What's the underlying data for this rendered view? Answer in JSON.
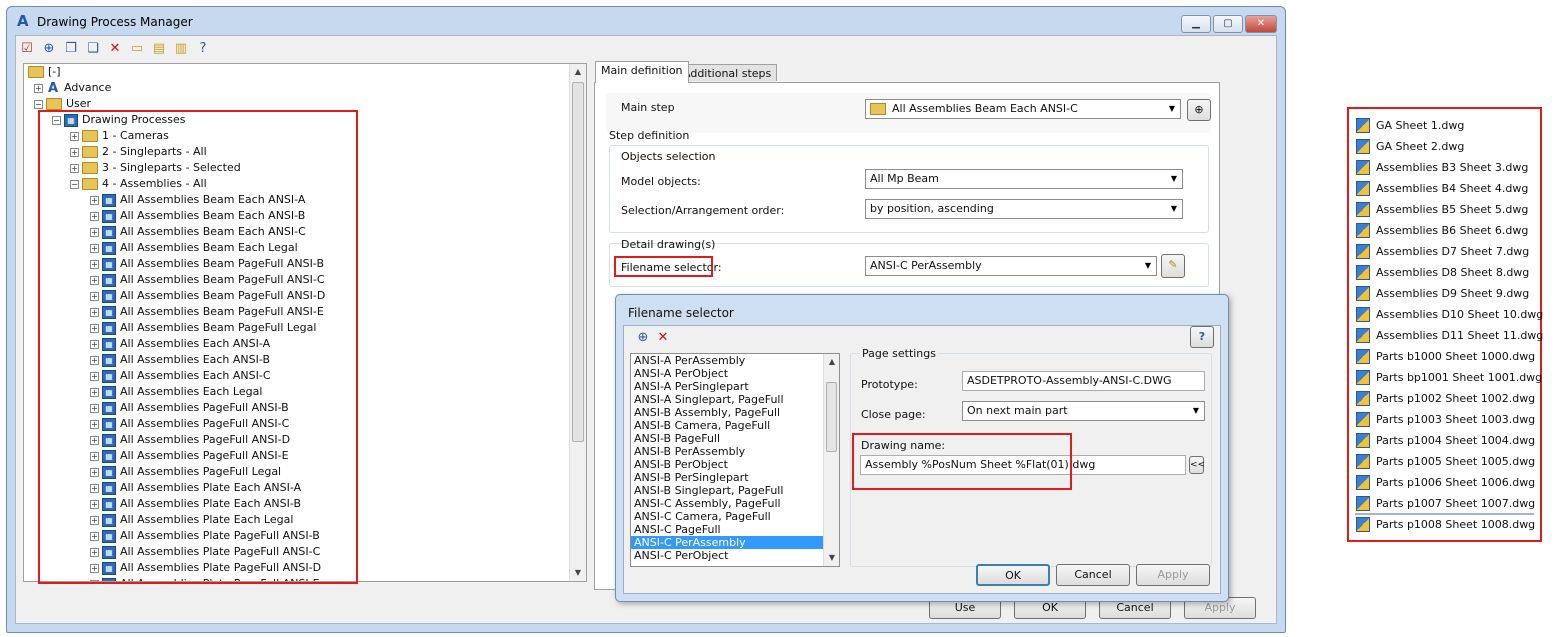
{
  "window": {
    "title": "Drawing Process Manager",
    "min": "▁",
    "max": "▢",
    "close": "✕"
  },
  "toolbar": {
    "icons": [
      "check-doc-icon",
      "add-icon",
      "copy-icon",
      "paste-icon",
      "delete-icon",
      "monitor-icon",
      "folder-open-icon",
      "folder-import-icon",
      "help-icon"
    ]
  },
  "tree": {
    "root": "[-]",
    "advance": "Advance",
    "user": "User",
    "drawing_processes": "Drawing Processes",
    "groups": [
      "1 - Cameras",
      "2 - Singleparts - All",
      "3 - Singleparts - Selected",
      "4 - Assemblies - All"
    ],
    "items": [
      "All Assemblies Beam Each ANSI-A",
      "All Assemblies Beam Each ANSI-B",
      "All Assemblies Beam Each ANSI-C",
      "All Assemblies Beam Each Legal",
      "All Assemblies Beam PageFull ANSI-B",
      "All Assemblies Beam PageFull ANSI-C",
      "All Assemblies Beam PageFull ANSI-D",
      "All Assemblies Beam PageFull ANSI-E",
      "All Assemblies Beam PageFull Legal",
      "All Assemblies Each ANSI-A",
      "All Assemblies Each ANSI-B",
      "All Assemblies Each ANSI-C",
      "All Assemblies Each Legal",
      "All Assemblies PageFull ANSI-B",
      "All Assemblies PageFull ANSI-C",
      "All Assemblies PageFull ANSI-D",
      "All Assemblies PageFull ANSI-E",
      "All Assemblies PageFull Legal",
      "All Assemblies Plate Each ANSI-A",
      "All Assemblies Plate Each ANSI-B",
      "All Assemblies Plate Each Legal",
      "All Assemblies Plate PageFull ANSI-B",
      "All Assemblies Plate PageFull ANSI-C",
      "All Assemblies Plate PageFull ANSI-D",
      "All Assemblies Plate PageFull ANSI-E"
    ]
  },
  "tabs": {
    "main": "Main definition",
    "additional": "Additional steps"
  },
  "main": {
    "main_step_label": "Main step",
    "main_step_value": "All Assemblies Beam Each ANSI-C",
    "step_definition": "Step definition",
    "objects_selection": "Objects selection",
    "model_objects_label": "Model objects:",
    "model_objects_value": "All Mp Beam",
    "order_label": "Selection/Arrangement order:",
    "order_value": "by position, ascending",
    "detail_drawings": "Detail drawing(s)",
    "filename_selector_label": "Filename selector:",
    "filename_selector_value": "ANSI-C PerAssembly"
  },
  "bottom_buttons": {
    "use": "Use",
    "ok": "OK",
    "cancel": "Cancel",
    "apply": "Apply"
  },
  "dialog": {
    "title": "Filename selector",
    "list": [
      "ANSI-A PerAssembly",
      "ANSI-A PerObject",
      "ANSI-A PerSinglepart",
      "ANSI-A Singlepart, PageFull",
      "ANSI-B Assembly, PageFull",
      "ANSI-B Camera, PageFull",
      "ANSI-B PageFull",
      "ANSI-B PerAssembly",
      "ANSI-B PerObject",
      "ANSI-B PerSinglepart",
      "ANSI-B Singlepart, PageFull",
      "ANSI-C Assembly, PageFull",
      "ANSI-C Camera, PageFull",
      "ANSI-C PageFull",
      "ANSI-C PerAssembly",
      "ANSI-C PerObject"
    ],
    "selected_index": 14,
    "page_settings": "Page settings",
    "prototype_label": "Prototype:",
    "prototype_value": "ASDETPROTO-Assembly-ANSI-C.DWG",
    "close_page_label": "Close page:",
    "close_page_value": "On next main part",
    "drawing_name_label": "Drawing name:",
    "drawing_name_value": "Assembly %PosNum Sheet %Flat(01).dwg",
    "insert_btn": "<<",
    "ok": "OK",
    "cancel": "Cancel",
    "apply": "Apply"
  },
  "files": [
    "GA Sheet 1.dwg",
    "GA Sheet 2.dwg",
    "Assemblies B3 Sheet 3.dwg",
    "Assemblies B4 Sheet 4.dwg",
    "Assemblies B5 Sheet 5.dwg",
    "Assemblies B6 Sheet 6.dwg",
    "Assemblies D7 Sheet 7.dwg",
    "Assemblies D8 Sheet 8.dwg",
    "Assemblies D9 Sheet 9.dwg",
    "Assemblies D10 Sheet 10.dwg",
    "Assemblies D11 Sheet 11.dwg",
    "Parts b1000 Sheet 1000.dwg",
    "Parts bp1001 Sheet 1001.dwg",
    "Parts p1002 Sheet 1002.dwg",
    "Parts p1003 Sheet 1003.dwg",
    "Parts p1004 Sheet 1004.dwg",
    "Parts p1005 Sheet 1005.dwg",
    "Parts p1006 Sheet 1006.dwg",
    "Parts p1007 Sheet 1007.dwg",
    "Parts p1008 Sheet 1008.dwg"
  ]
}
